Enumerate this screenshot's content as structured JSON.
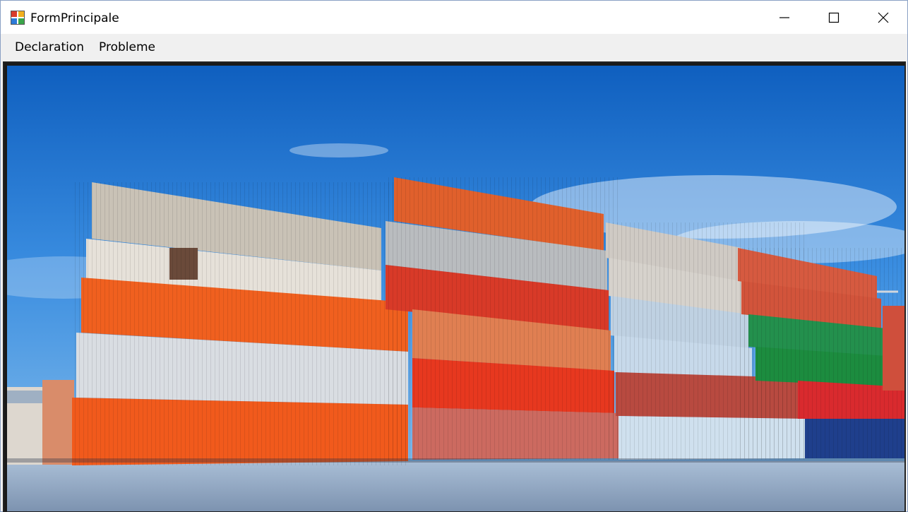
{
  "window": {
    "title": "FormPrincipale"
  },
  "menu": {
    "items": [
      "Declaration",
      "Probleme"
    ]
  },
  "picture": {
    "description_icon": "shipping-containers-photo"
  },
  "colors": {
    "sky_top": "#1f6fc8",
    "container_orange": "#f05a1e",
    "container_white": "#d8dde2",
    "container_red": "#d6402f",
    "container_green": "#1f8a45",
    "container_blue": "#1f3f8c"
  }
}
